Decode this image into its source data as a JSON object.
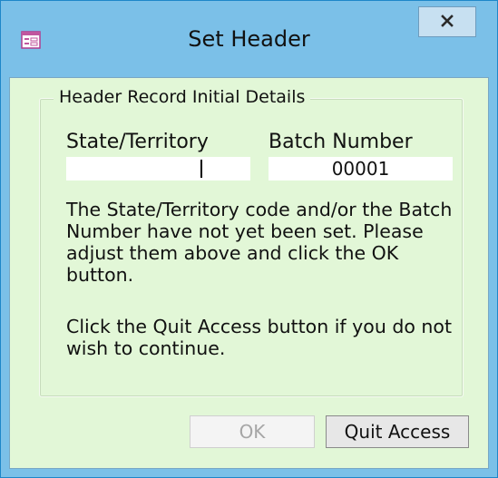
{
  "window": {
    "title": "Set Header",
    "close_label": "X"
  },
  "icons": {
    "app": "form-icon",
    "close": "close-icon",
    "dropdown": "chevron-down-icon"
  },
  "form": {
    "group_title": "Header Record Initial Details",
    "state_label": "State/Territory",
    "state_value": "",
    "batch_label": "Batch Number",
    "batch_value": "00001",
    "message_1": "The State/Territory code and/or the Batch Number have not yet been set. Please adjust them above and click the OK button.",
    "message_2": "Click the Quit Access button if you do not wish to continue."
  },
  "buttons": {
    "ok_label": "OK",
    "quit_label": "Quit Access"
  },
  "colors": {
    "title_bar": "#7bc0e8",
    "client_background": "#e2f7d7",
    "disabled_text": "#a6a6a6"
  }
}
